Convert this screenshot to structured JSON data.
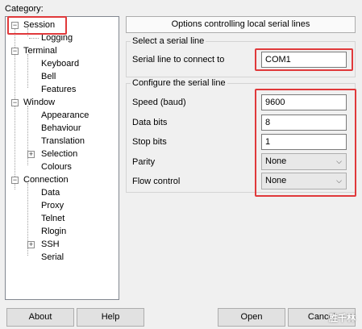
{
  "category_label": "Category:",
  "tree": {
    "items": [
      {
        "label": "Session"
      },
      {
        "label": "Logging"
      },
      {
        "label": "Terminal"
      },
      {
        "label": "Keyboard"
      },
      {
        "label": "Bell"
      },
      {
        "label": "Features"
      },
      {
        "label": "Window"
      },
      {
        "label": "Appearance"
      },
      {
        "label": "Behaviour"
      },
      {
        "label": "Translation"
      },
      {
        "label": "Selection"
      },
      {
        "label": "Colours"
      },
      {
        "label": "Connection"
      },
      {
        "label": "Data"
      },
      {
        "label": "Proxy"
      },
      {
        "label": "Telnet"
      },
      {
        "label": "Rlogin"
      },
      {
        "label": "SSH"
      },
      {
        "label": "Serial"
      }
    ]
  },
  "panel": {
    "header": "Options controlling local serial lines",
    "select_group": {
      "title": "Select a serial line",
      "line_label": "Serial line to connect to",
      "line_value": "COM1"
    },
    "config_group": {
      "title": "Configure the serial line",
      "speed_label": "Speed (baud)",
      "speed_value": "9600",
      "databits_label": "Data bits",
      "databits_value": "8",
      "stopbits_label": "Stop bits",
      "stopbits_value": "1",
      "parity_label": "Parity",
      "parity_value": "None",
      "flow_label": "Flow control",
      "flow_value": "None"
    }
  },
  "buttons": {
    "about": "About",
    "help": "Help",
    "open": "Open",
    "cancel": "Cancel"
  },
  "icons": {
    "tree_expanded": "minus-box-icon",
    "tree_collapsed": "plus-box-icon",
    "dropdown": "chevron-down-icon"
  },
  "accent_color": "#e0393b",
  "watermark": "胜千林"
}
